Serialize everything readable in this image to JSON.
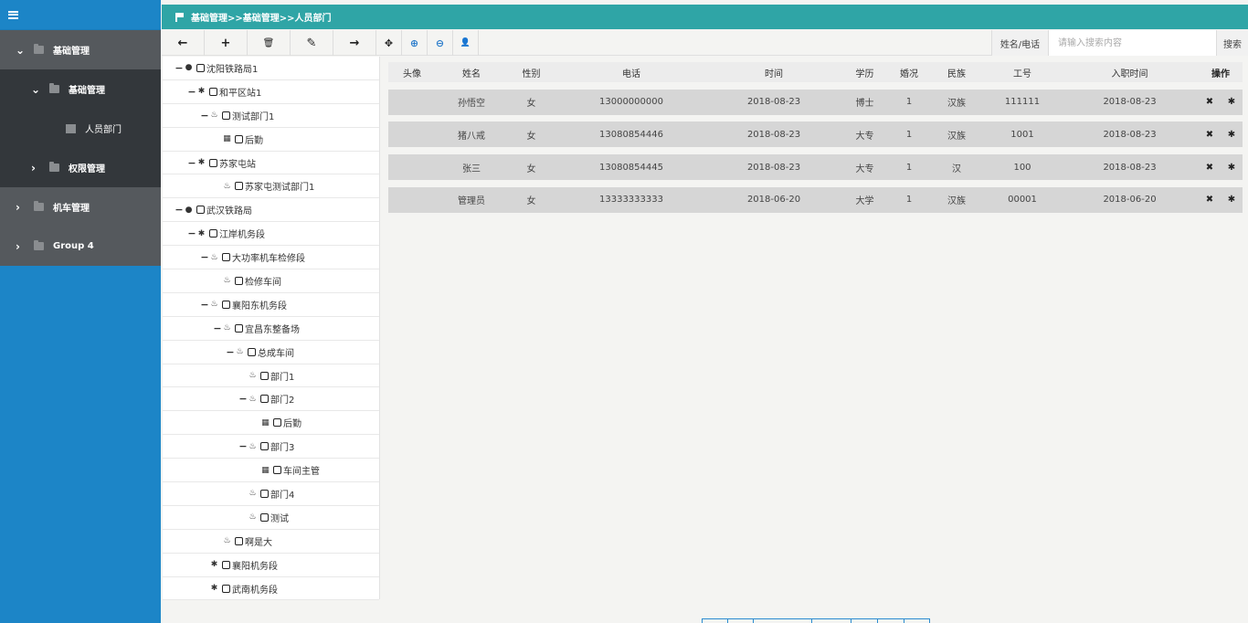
{
  "sidebar": {
    "items": [
      {
        "label": "基础管理",
        "chevron": "v",
        "icon": "folder-open-icon"
      },
      {
        "label": "基础管理",
        "chevron": "v",
        "icon": "folder-open-icon"
      },
      {
        "label": "人员部门",
        "chevron": "",
        "icon": "picture-icon"
      },
      {
        "label": "权限管理",
        "chevron": ">",
        "icon": "folder-icon"
      },
      {
        "label": "机车管理",
        "chevron": ">",
        "icon": "folder-icon"
      },
      {
        "label": "Group 4",
        "chevron": ">",
        "icon": "folder-icon"
      }
    ]
  },
  "header": {
    "breadcrumb": "基础管理>>基础管理>>人员部门"
  },
  "toolbar": {
    "search_label": "姓名/电话",
    "search_placeholder": "请输入搜索内容",
    "search_button": "搜索",
    "buttons": {
      "back": "←",
      "add": "+",
      "delete": "🗑",
      "edit": "✎",
      "forward": "→",
      "move": "✥",
      "up": "⊕",
      "down": "⊖",
      "user": "👤"
    }
  },
  "tree": [
    {
      "label": "沈阳铁路局1",
      "indent": 0,
      "exp": "−",
      "icon": "●"
    },
    {
      "label": "和平区站1",
      "indent": 1,
      "exp": "−",
      "icon": "✱"
    },
    {
      "label": "测试部门1",
      "indent": 2,
      "exp": "−",
      "icon": "♨"
    },
    {
      "label": "后勤",
      "indent": 3,
      "exp": "",
      "icon": "▦"
    },
    {
      "label": "苏家屯站",
      "indent": 1,
      "exp": "−",
      "icon": "✱"
    },
    {
      "label": "苏家屯测试部门1",
      "indent": 3,
      "exp": "",
      "icon": "♨"
    },
    {
      "label": "武汉铁路局",
      "indent": 0,
      "exp": "−",
      "icon": "●"
    },
    {
      "label": "江岸机务段",
      "indent": 1,
      "exp": "−",
      "icon": "✱"
    },
    {
      "label": "大功率机车检修段",
      "indent": 2,
      "exp": "−",
      "icon": "♨"
    },
    {
      "label": "检修车间",
      "indent": 3,
      "exp": "",
      "icon": "♨"
    },
    {
      "label": "襄阳东机务段",
      "indent": 2,
      "exp": "−",
      "icon": "♨"
    },
    {
      "label": "宜昌东整备场",
      "indent": 3,
      "exp": "−",
      "icon": "♨"
    },
    {
      "label": "总成车间",
      "indent": 4,
      "exp": "−",
      "icon": "♨"
    },
    {
      "label": "部门1",
      "indent": 5,
      "exp": "",
      "icon": "♨"
    },
    {
      "label": "部门2",
      "indent": 5,
      "exp": "−",
      "icon": "♨"
    },
    {
      "label": "后勤",
      "indent": 6,
      "exp": "",
      "icon": "▦"
    },
    {
      "label": "部门3",
      "indent": 5,
      "exp": "−",
      "icon": "♨"
    },
    {
      "label": "车间主管",
      "indent": 6,
      "exp": "",
      "icon": "▦"
    },
    {
      "label": "部门4",
      "indent": 5,
      "exp": "",
      "icon": "♨"
    },
    {
      "label": "测试",
      "indent": 5,
      "exp": "",
      "icon": "♨"
    },
    {
      "label": "啊是大",
      "indent": 3,
      "exp": "",
      "icon": "♨"
    },
    {
      "label": "襄阳机务段",
      "indent": 2,
      "exp": "",
      "icon": "✱"
    },
    {
      "label": "武南机务段",
      "indent": 2,
      "exp": "",
      "icon": "✱"
    }
  ],
  "table": {
    "columns": [
      "头像",
      "姓名",
      "性别",
      "电话",
      "时间",
      "学历",
      "婚况",
      "民族",
      "工号",
      "入职时间",
      "操作"
    ],
    "rows": [
      [
        "",
        "孙悟空",
        "女",
        "13000000000",
        "2018-08-23",
        "博士",
        "1",
        "汉族",
        "111111",
        "2018-08-23"
      ],
      [
        "",
        "猪八戒",
        "女",
        "13080854446",
        "2018-08-23",
        "大专",
        "1",
        "汉族",
        "1001",
        "2018-08-23"
      ],
      [
        "",
        "张三",
        "女",
        "13080854445",
        "2018-08-23",
        "大专",
        "1",
        "汉",
        "100",
        "2018-08-23"
      ],
      [
        "",
        "管理员",
        "女",
        "13333333333",
        "2018-06-20",
        "大学",
        "1",
        "汉族",
        "00001",
        "2018-06-20"
      ]
    ],
    "row_actions": [
      "✖",
      "✱"
    ]
  },
  "colors": {
    "sidebar": "#1c85c7",
    "header": "#2fa5a6",
    "nav_dark": "#404448"
  }
}
